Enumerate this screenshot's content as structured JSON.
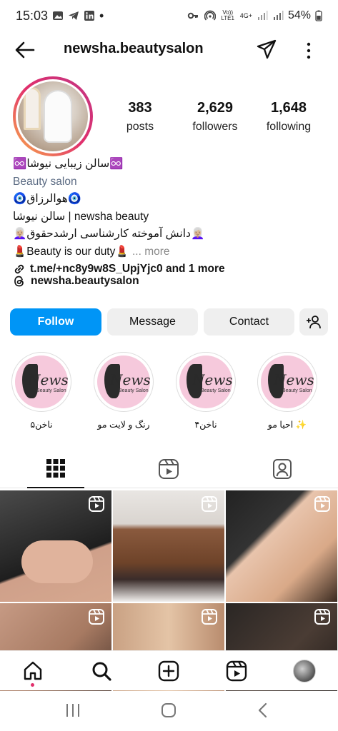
{
  "status_bar": {
    "time": "15:03",
    "network": "Vo)) LTE1",
    "network_type": "4G+",
    "battery": "54%",
    "icons": [
      "gallery-icon",
      "telegram-icon",
      "linkedin-icon",
      "dot-icon",
      "key-icon",
      "hotspot-icon",
      "signal-icon",
      "battery-icon"
    ]
  },
  "header": {
    "username": "newsha.beautysalon",
    "icons": [
      "back-arrow-icon",
      "send-icon",
      "more-vertical-icon"
    ]
  },
  "stats": [
    {
      "value": "383",
      "label": "posts"
    },
    {
      "value": "2,629",
      "label": "followers"
    },
    {
      "value": "1,648",
      "label": "following"
    }
  ],
  "bio": {
    "name": "♾️سالن زیبایی نیوشا♾️",
    "category": "Beauty salon",
    "line1": "🧿هوالرزاق🧿",
    "line2": "سالن نیوشا | newsha beauty",
    "line3": "👩🏼‍🦳دانش آموخته کارشناسی ارشدحقوق👩🏼‍🦳",
    "line4": "💄Beauty is our duty💄",
    "more_label": "... more",
    "link": "t.me/+nc8y9w8S_UpjYjc0 and 1 more",
    "threads_handle": "newsha.beautysalon"
  },
  "actions": {
    "follow": "Follow",
    "message": "Message",
    "contact": "Contact"
  },
  "highlights": [
    {
      "label": "ناخن۵",
      "brand": "Newsha",
      "sub": "Beauty Salon"
    },
    {
      "label": "رنگ و لایت مو",
      "brand": "Newsha",
      "sub": "Beauty Salon"
    },
    {
      "label": "ناخن۴",
      "brand": "Newsha",
      "sub": "Beauty Salon"
    },
    {
      "label": "احیا مو ✨",
      "brand": "Newsha",
      "sub": "Beauty Salon"
    }
  ],
  "tabs": [
    "grid-icon",
    "reels-icon",
    "tagged-icon"
  ],
  "bottom_nav": [
    "home-icon",
    "search-icon",
    "create-icon",
    "reels-icon",
    "profile-avatar"
  ],
  "colors": {
    "primary": "#0095f6",
    "secondary_button": "#efefef",
    "ring_gradient": [
      "#f9b04a",
      "#e1306c",
      "#c13584"
    ],
    "highlight_bg": "#f6c9dc"
  }
}
